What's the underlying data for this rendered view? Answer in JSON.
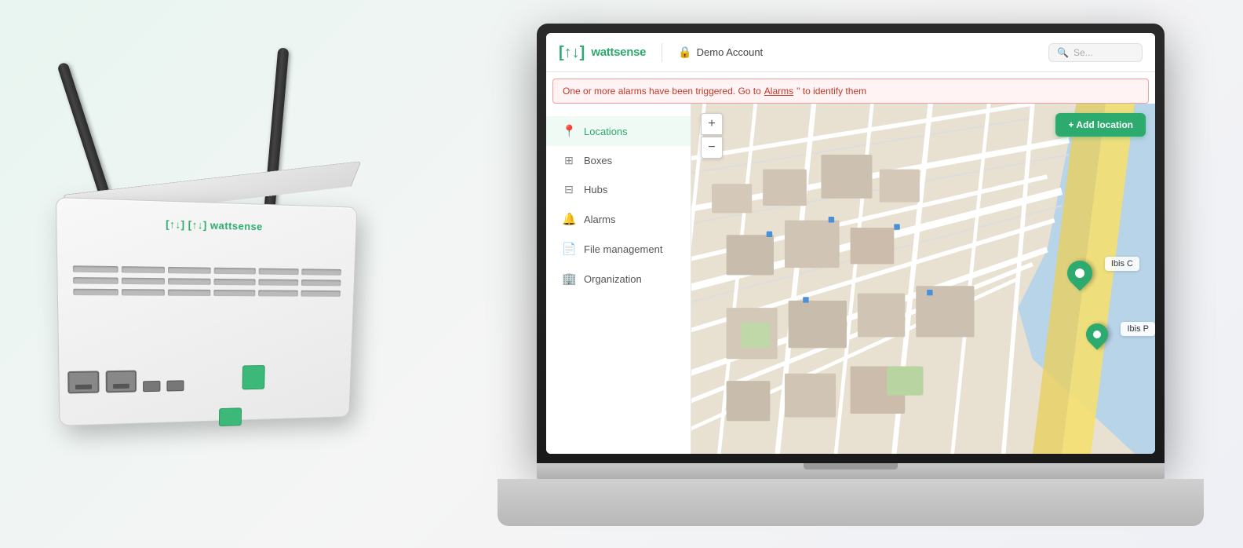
{
  "app": {
    "logo_icon": "[↑↓]",
    "logo_text_watt": "watt",
    "logo_text_sense": "sense",
    "account_icon": "🔒",
    "account_label": "Demo Account",
    "search_placeholder": "Se..."
  },
  "alert": {
    "message": "One or more alarms have been triggered. Go to ",
    "link_text": "Alarms",
    "message_end": "\" to identify them"
  },
  "sidebar": {
    "items": [
      {
        "id": "locations",
        "label": "Locations",
        "icon": "📍",
        "active": true
      },
      {
        "id": "boxes",
        "label": "Boxes",
        "icon": "⊞",
        "active": false
      },
      {
        "id": "hubs",
        "label": "Hubs",
        "icon": "⊟",
        "active": false
      },
      {
        "id": "alarms",
        "label": "Alarms",
        "icon": "🔔",
        "active": false
      },
      {
        "id": "file-management",
        "label": "File management",
        "icon": "📄",
        "active": false
      },
      {
        "id": "organization",
        "label": "Organization",
        "icon": "🏢",
        "active": false
      }
    ]
  },
  "map": {
    "zoom_in": "+",
    "zoom_out": "−",
    "marker1_label": "Ibis C",
    "marker2_label": "Ibis P",
    "add_button": "+ Add location"
  },
  "device": {
    "logo": "[↑↓] wattsense"
  }
}
